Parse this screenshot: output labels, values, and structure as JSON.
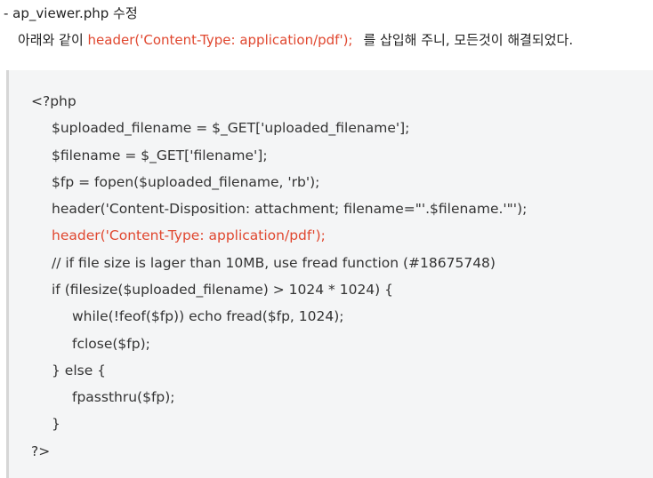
{
  "description": {
    "file_line": "- ap_viewer.php 수정",
    "sentence_before": "아래와 같이 ",
    "sentence_highlight": "header('Content-Type: application/pdf');",
    "sentence_after": "를 삽입해 주니, 모든것이 해결되었다."
  },
  "code": {
    "lines": [
      "<?php",
      "$uploaded_filename = $_GET['uploaded_filename'];",
      "$filename = $_GET['filename'];",
      "$fp = fopen($uploaded_filename, 'rb');",
      "header('Content-Disposition: attachment; filename=\"'.$filename.'\"');",
      "header('Content-Type: application/pdf');",
      "// if file size is lager than 10MB, use fread function (#18675748)",
      "if (filesize($uploaded_filename) > 1024 * 1024) {",
      "while(!feof($fp)) echo fread($fp, 1024);",
      "fclose($fp);",
      "} else {",
      "fpassthru($fp);",
      "}",
      "?>"
    ],
    "highlight_color": "#e0472f"
  }
}
